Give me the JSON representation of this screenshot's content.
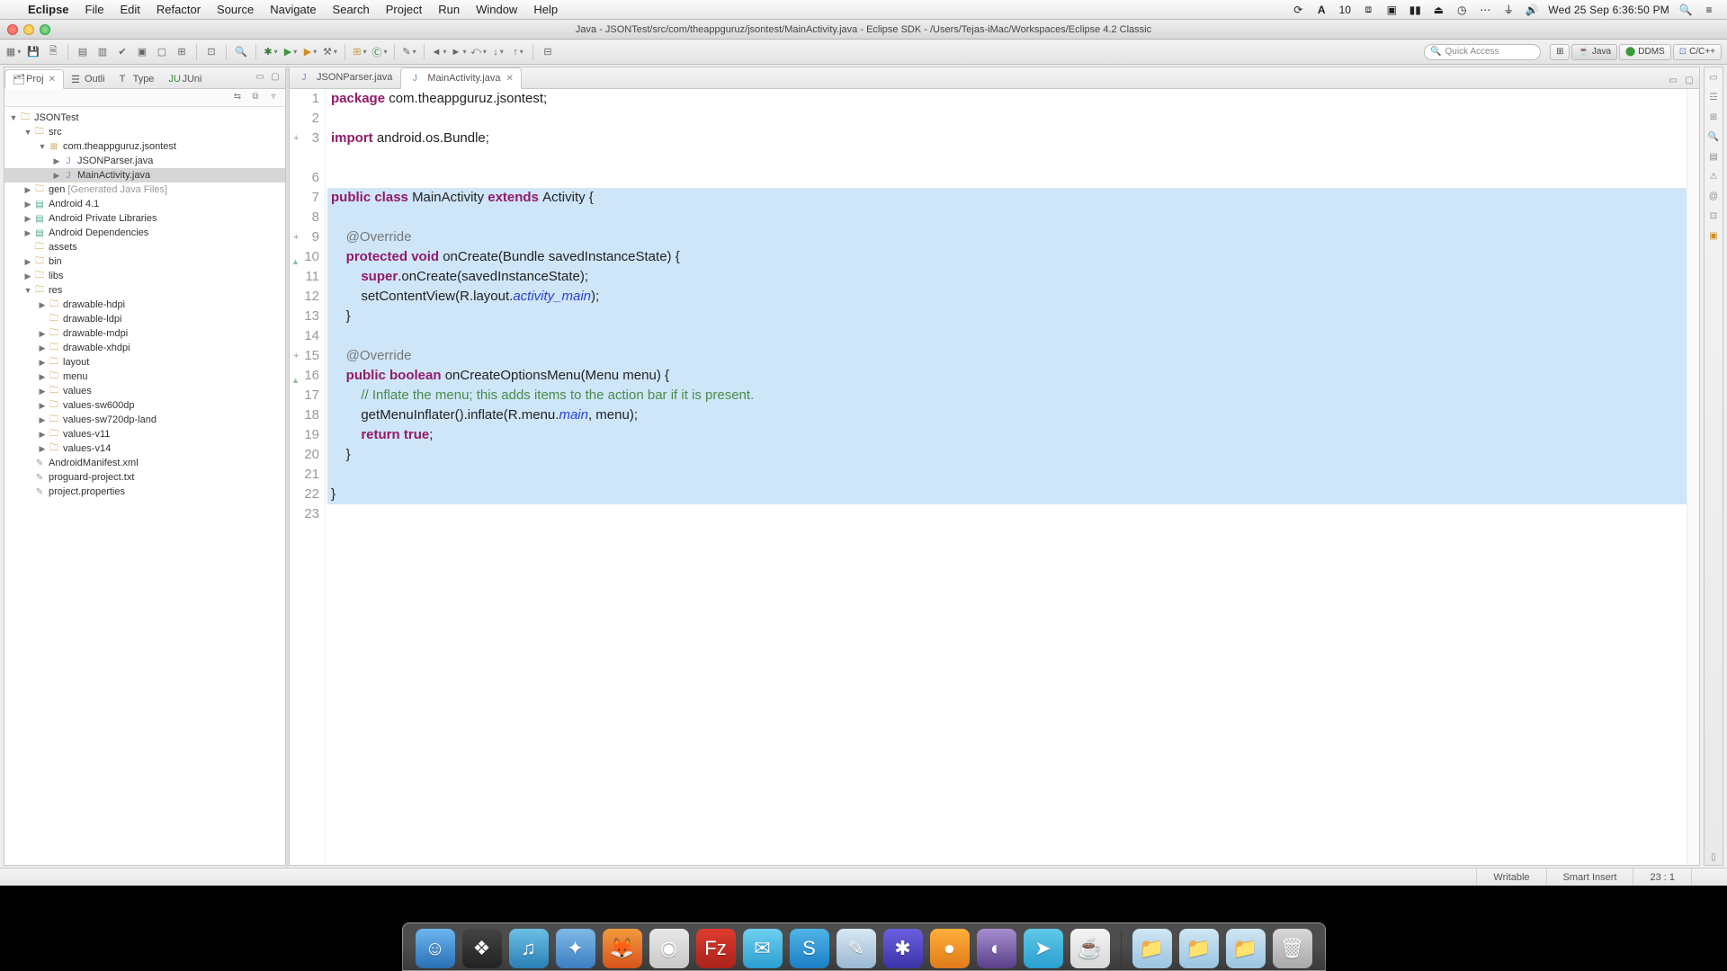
{
  "menubar": {
    "app": "Eclipse",
    "items": [
      "File",
      "Edit",
      "Refactor",
      "Source",
      "Navigate",
      "Search",
      "Project",
      "Run",
      "Window",
      "Help"
    ],
    "right": {
      "badge": "10",
      "clock": "Wed 25 Sep  6:36:50 PM"
    }
  },
  "window": {
    "title": "Java - JSONTest/src/com/theappguruz/jsontest/MainActivity.java - Eclipse SDK - /Users/Tejas-iMac/Workspaces/Eclipse 4.2 Classic"
  },
  "quick_access": {
    "placeholder": "Quick Access"
  },
  "perspectives": [
    {
      "label": "Java",
      "active": true
    },
    {
      "label": "DDMS",
      "active": false
    },
    {
      "label": "C/C++",
      "active": false
    }
  ],
  "left_views": {
    "tabs": [
      {
        "label": "Proj",
        "active": true,
        "closable": true
      },
      {
        "label": "Outli",
        "active": false
      },
      {
        "label": "Type",
        "active": false
      },
      {
        "label": "JUni",
        "active": false
      }
    ]
  },
  "tree": {
    "project": "JSONTest",
    "src": "src",
    "pkg": "com.theappguruz.jsontest",
    "files": [
      "JSONParser.java",
      "MainActivity.java"
    ],
    "gen": {
      "label": "gen",
      "hint": "[Generated Java Files]"
    },
    "libs": [
      "Android 4.1",
      "Android Private Libraries",
      "Android Dependencies"
    ],
    "plain": [
      "assets",
      "bin",
      "libs"
    ],
    "res": "res",
    "res_children": [
      "drawable-hdpi",
      "drawable-ldpi",
      "drawable-mdpi",
      "drawable-xhdpi",
      "layout",
      "menu",
      "values",
      "values-sw600dp",
      "values-sw720dp-land",
      "values-v11",
      "values-v14"
    ],
    "root_files": [
      "AndroidManifest.xml",
      "proguard-project.txt",
      "project.properties"
    ]
  },
  "editor": {
    "tabs": [
      {
        "label": "JSONParser.java",
        "active": false
      },
      {
        "label": "MainActivity.java",
        "active": true
      }
    ],
    "code": {
      "l1a": "package ",
      "l1b": "com.theappguruz.jsontest;",
      "l3a": "import ",
      "l3b": "android.os.Bundle;",
      "l7a": "public ",
      "l7b": "class ",
      "l7c": "MainActivity ",
      "l7d": "extends ",
      "l7e": "Activity {",
      "l9": "@Override",
      "l10a": "protected ",
      "l10b": "void ",
      "l10c": "onCreate(Bundle savedInstanceState) {",
      "l11a": "super",
      "l11b": ".onCreate(savedInstanceState);",
      "l12a": "setContentView(R.layout.",
      "l12b": "activity_main",
      "l12c": ");",
      "l13": "}",
      "l15": "@Override",
      "l16a": "public ",
      "l16b": "boolean ",
      "l16c": "onCreateOptionsMenu(Menu menu) {",
      "l17": "// Inflate the menu; this adds items to the action bar if it is present.",
      "l18a": "getMenuInflater().inflate(R.menu.",
      "l18b": "main",
      "l18c": ", menu);",
      "l19a": "return ",
      "l19b": "true",
      "l19c": ";",
      "l20": "}",
      "l22": "}"
    }
  },
  "status": {
    "writable": "Writable",
    "insert": "Smart Insert",
    "pos": "23 : 1"
  },
  "dock": {
    "apps": [
      {
        "name": "finder",
        "bg": "linear-gradient(#6bb7f0,#2a6fb5)",
        "glyph": "☺"
      },
      {
        "name": "mission",
        "bg": "linear-gradient(#444,#222)",
        "glyph": "❖"
      },
      {
        "name": "itunes",
        "bg": "linear-gradient(#6cc0e5,#2a7fb5)",
        "glyph": "♫"
      },
      {
        "name": "safari",
        "bg": "linear-gradient(#7fb9e6,#3b7ec2)",
        "glyph": "✦"
      },
      {
        "name": "firefox",
        "bg": "linear-gradient(#f39a3b,#d8541c)",
        "glyph": "🦊"
      },
      {
        "name": "chrome",
        "bg": "linear-gradient(#e8e8e8,#c8c8c8)",
        "glyph": "◉"
      },
      {
        "name": "filezilla",
        "bg": "linear-gradient(#e03b2f,#a8231a)",
        "glyph": "Fz"
      },
      {
        "name": "messages",
        "bg": "linear-gradient(#6fd0f0,#2a9fd0)",
        "glyph": "✉"
      },
      {
        "name": "skype",
        "bg": "linear-gradient(#4fb4e8,#1b7fc4)",
        "glyph": "S"
      },
      {
        "name": "textedit",
        "bg": "linear-gradient(#d8e8f4,#9bb8d2)",
        "glyph": "✎"
      },
      {
        "name": "app1",
        "bg": "linear-gradient(#6a5fe0,#3c34a8)",
        "glyph": "✱"
      },
      {
        "name": "app2",
        "bg": "linear-gradient(#ffb03a,#e07a1a)",
        "glyph": "●"
      },
      {
        "name": "eclipse",
        "bg": "linear-gradient(#a88fd0,#5a3f8a)",
        "glyph": "◐"
      },
      {
        "name": "app3",
        "bg": "linear-gradient(#5fc8e8,#2a9fd0)",
        "glyph": "➤"
      },
      {
        "name": "java",
        "bg": "linear-gradient(#f4f4f4,#d8d8d8)",
        "glyph": "☕"
      }
    ],
    "right": [
      {
        "name": "folder1",
        "bg": "linear-gradient(#cfe6f4,#9bc4e0)",
        "glyph": "📁"
      },
      {
        "name": "folder2",
        "bg": "linear-gradient(#cfe6f4,#9bc4e0)",
        "glyph": "📁"
      },
      {
        "name": "folder3",
        "bg": "linear-gradient(#cfe6f4,#9bc4e0)",
        "glyph": "📁"
      },
      {
        "name": "trash",
        "bg": "linear-gradient(#d8d8d8,#a8a8a8)",
        "glyph": "🗑"
      }
    ]
  }
}
